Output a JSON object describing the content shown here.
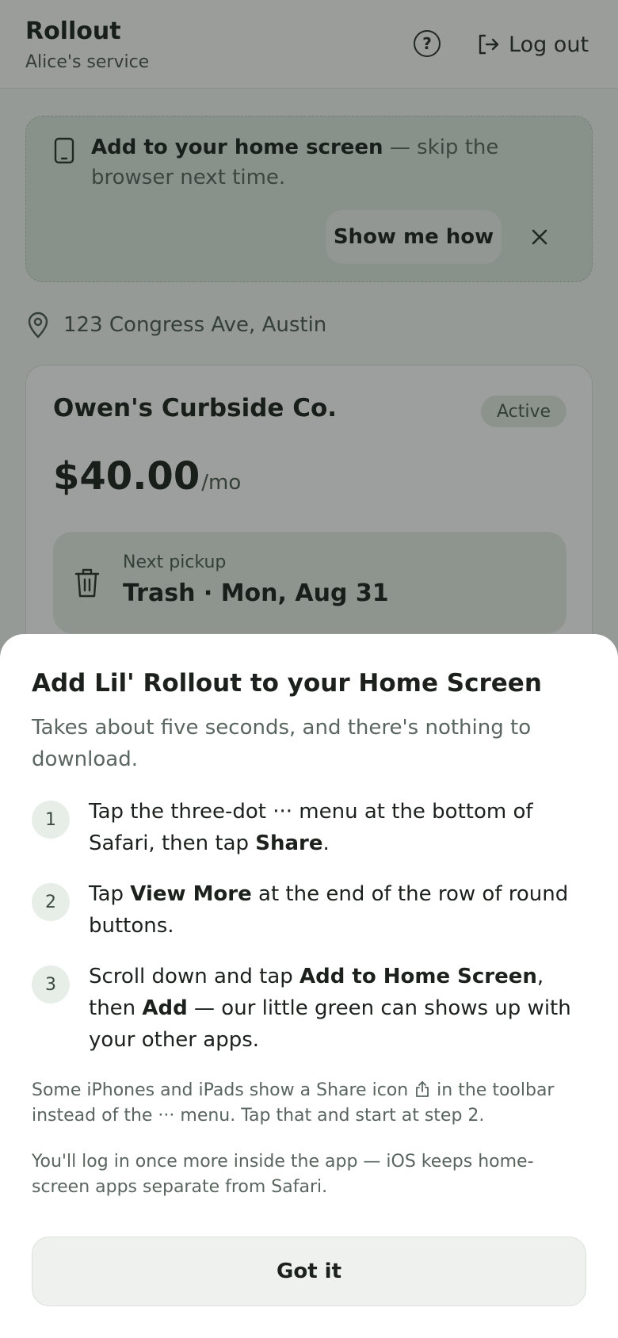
{
  "header": {
    "title": "Rollout",
    "subtitle": "Alice's service",
    "help_label": "?",
    "logout_label": "Log out"
  },
  "banner": {
    "bold_text": "Add to your home screen",
    "rest_text": " — skip the browser next time.",
    "show_me_label": "Show me how"
  },
  "address": "123 Congress Ave, Austin",
  "service": {
    "name": "Owen's Curbside Co.",
    "status": "Active",
    "price": "$40.00",
    "price_unit": "/mo",
    "pickup_label": "Next pickup",
    "pickup_value": "Trash · Mon, Aug 31"
  },
  "sheet": {
    "title": "Add Lil' Rollout to your Home Screen",
    "subtitle": "Takes about five seconds, and there's nothing to download.",
    "steps": [
      {
        "num": "1",
        "t1": "Tap the three-dot ··· menu at the bottom of Safari, then tap ",
        "b1": "Share",
        "t2": "."
      },
      {
        "num": "2",
        "t1": "Tap ",
        "b1": "View More",
        "t2": " at the end of the row of round buttons."
      },
      {
        "num": "3",
        "t1": "Scroll down and tap ",
        "b1": "Add to Home Screen",
        "t2": ", then ",
        "b2": "Add",
        "t3": " — our little green can shows up with your other apps."
      }
    ],
    "note1_a": "Some iPhones and iPads show a Share icon ",
    "note1_b": " in the toolbar instead of the ··· menu. Tap that and start at step 2.",
    "note2": "You'll log in once more inside the app — iOS keeps home-screen apps separate from Safari.",
    "got_it_label": "Got it"
  },
  "colors": {
    "accent_green": "#e7eee7",
    "text_dark": "#1c211e",
    "text_muted": "#5a6560"
  }
}
